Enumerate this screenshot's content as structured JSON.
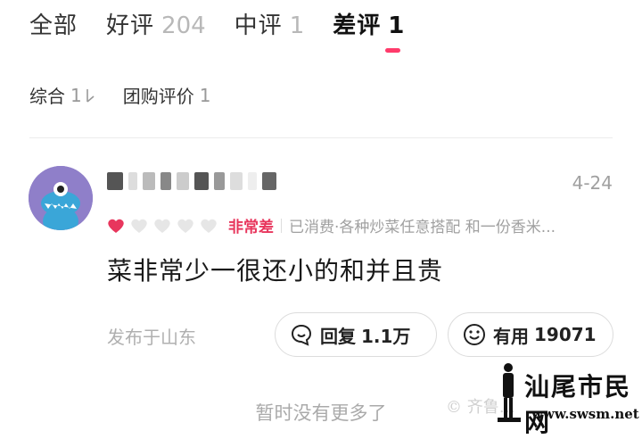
{
  "tabs": [
    {
      "label": "全部",
      "count": ""
    },
    {
      "label": "好评",
      "count": "204"
    },
    {
      "label": "中评",
      "count": "1"
    },
    {
      "label": "差评",
      "count": "1"
    }
  ],
  "active_tab": "差评",
  "filters": [
    {
      "label": "综合",
      "count": "1"
    },
    {
      "label": "团购评价",
      "count": "1"
    }
  ],
  "review": {
    "date": "4-24",
    "rating_text": "非常差",
    "rating_level": 1,
    "rating_max": 5,
    "consume_info": "已消费·各种炒菜任意搭配 和一份香米...",
    "content": "菜非常少一很还小的和并且贵",
    "location": "发布于山东",
    "reply_label": "回复",
    "reply_count": "1.1万",
    "useful_label": "有用",
    "useful_count": "19071"
  },
  "footer": {
    "no_more": "暂时没有更多了"
  },
  "watermark": {
    "weibo": "© 齐鲁…",
    "site_name": "汕尾市民网",
    "url": "www.swsm.net"
  },
  "colors": {
    "accent": "#ff3b6b",
    "rating_red": "#e8365d",
    "muted": "#a0a0a0",
    "avatar_bg": "#8f7fc9"
  },
  "icons": [
    "sort-icon",
    "heart-icon",
    "reply-icon",
    "smile-icon"
  ]
}
